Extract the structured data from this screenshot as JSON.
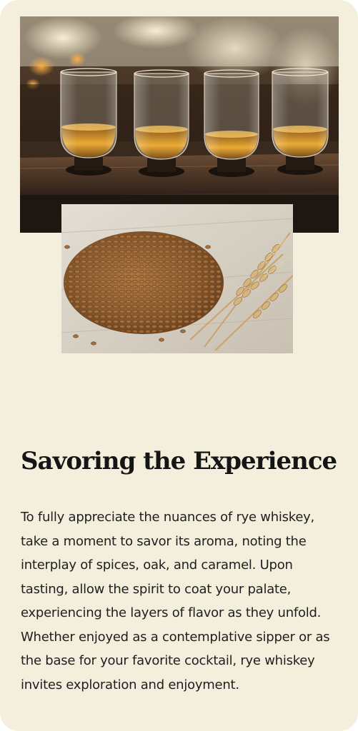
{
  "images": {
    "top": {
      "alt": "",
      "icon": "whiskey-tasting-flight-photo",
      "colors": {
        "background": "#3b2a1d",
        "liquid": "#c98a1d",
        "board": "#4a3423"
      }
    },
    "bottom": {
      "alt": "",
      "icon": "rye-grain-and-wheat-stalks-photo",
      "colors": {
        "background": "#d8d2c6",
        "grain": "#8a5a2e",
        "stalk": "#c9a36c"
      }
    }
  },
  "section": {
    "heading": "Savoring the Experience",
    "body": "To fully appreciate the nuances of rye whiskey, take a moment to savor its aroma, noting the interplay of spices, oak, and caramel. Upon tasting, allow the spirit to coat your palate, experiencing the layers of flavor as they unfold. Whether enjoyed as a contemplative sipper or as the base for your favorite cocktail, rye whiskey invites exploration and enjoyment."
  },
  "theme": {
    "card_background": "#f4efdd",
    "heading_color": "#151515",
    "text_color": "#1e1e1e"
  }
}
